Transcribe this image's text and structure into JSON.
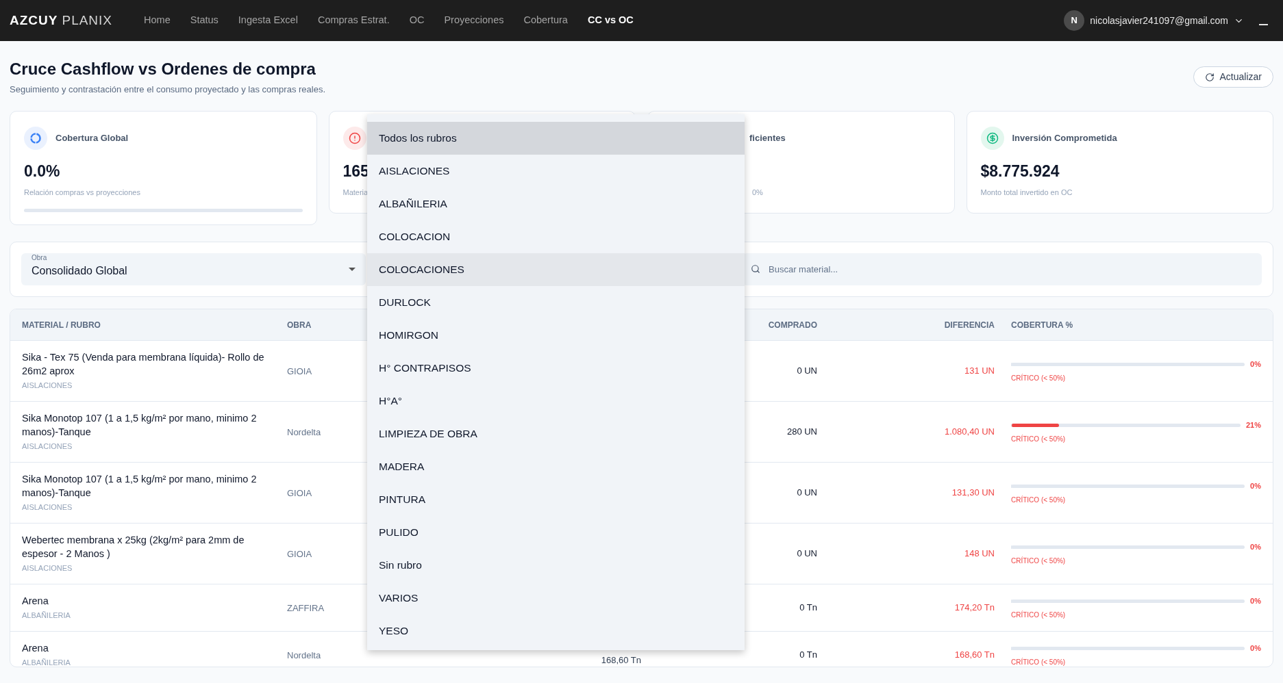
{
  "nav": {
    "brand_bold": "AZCUY",
    "brand_light": "PLANIX",
    "items": [
      {
        "label": "Home",
        "selected": false
      },
      {
        "label": "Status",
        "selected": false
      },
      {
        "label": "Ingesta Excel",
        "selected": false
      },
      {
        "label": "Compras Estrat.",
        "selected": false
      },
      {
        "label": "OC",
        "selected": false
      },
      {
        "label": "Proyecciones",
        "selected": false
      },
      {
        "label": "Cobertura",
        "selected": false
      },
      {
        "label": "CC vs OC",
        "selected": true
      }
    ],
    "user": {
      "avatar": "N",
      "email": "nicolasjavier241097@gmail.com"
    }
  },
  "page": {
    "title": "Cruce Cashflow vs Ordenes de compra",
    "subtitle": "Seguimiento y contrastación entre el consumo proyectado y las compras reales.",
    "refresh_button": "Actualizar"
  },
  "stat_cards": [
    {
      "kind": "coverage",
      "title": "Cobertura Global",
      "value": "0.0%",
      "caption": "Relación compras vs proyecciones",
      "level": 0
    },
    {
      "kind": "alert",
      "value": "165",
      "caption": "Materia"
    },
    {
      "kind": "partial",
      "title": "ficientes",
      "caption": "0%"
    },
    {
      "kind": "investment",
      "title": "Inversión Comprometida",
      "value": "$8.775.924",
      "caption": "Monto total invertido en OC"
    }
  ],
  "filters": {
    "obra": {
      "label": "Obra",
      "value": "Consolidado Global"
    },
    "search": {
      "placeholder": "Buscar material..."
    }
  },
  "table": {
    "columns": [
      "MATERIAL / RUBRO",
      "OBRA",
      "COMPRADO",
      "DIFERENCIA",
      "COBERTURA %"
    ],
    "rows": [
      {
        "material": "Sika - Tex 75 (Venda para membrana líquida)- Rollo de 26m2 aprox",
        "rubro": "AISLACIONES",
        "obra": "GIOIA",
        "comprado": "0 UN",
        "diferencia": "131 UN",
        "coverage": "0%",
        "level": 0,
        "status": {
          "label": "CRÍTICO (< 50%)",
          "kind": "critical"
        }
      },
      {
        "material": "Sika Monotop 107 (1 a 1,5 kg/m² por mano,  minimo 2 manos)-Tanque",
        "rubro": "AISLACIONES",
        "obra": "Nordelta",
        "comprado": "280 UN",
        "diferencia": "1.080,40 UN",
        "coverage": "21%",
        "level": 0.21,
        "status": {
          "label": "CRÍTICO (< 50%)",
          "kind": "critical"
        }
      },
      {
        "material": "Sika Monotop 107 (1 a 1,5 kg/m² por mano,  minimo 2 manos)-Tanque",
        "rubro": "AISLACIONES",
        "obra": "GIOIA",
        "comprado": "0 UN",
        "diferencia": "131,30 UN",
        "coverage": "0%",
        "level": 0,
        "status": {
          "label": "CRÍTICO (< 50%)",
          "kind": "critical"
        }
      },
      {
        "material": "Webertec membrana x 25kg (2kg/m² para 2mm de espesor - 2 Manos )",
        "rubro": "AISLACIONES",
        "obra": "GIOIA",
        "comprado": "0 UN",
        "diferencia": "148 UN",
        "coverage": "0%",
        "level": 0,
        "status": {
          "label": "CRÍTICO (< 50%)",
          "kind": "critical"
        }
      },
      {
        "material": "Arena",
        "rubro": "ALBAÑILERIA",
        "obra": "ZAFFIRA",
        "comprado": "0 Tn",
        "diferencia": "174,20 Tn",
        "coverage": "0%",
        "level": 0,
        "status": {
          "label": "CRÍTICO (< 50%)",
          "kind": "critical"
        }
      },
      {
        "material": "Arena",
        "rubro": "ALBAÑILERIA",
        "obra": "Nordelta",
        "column_3": "168,60 Tn",
        "comprado": "0 Tn",
        "diferencia": "168,60 Tn",
        "coverage": "0%",
        "level": 0,
        "status": {
          "label": "CRÍTICO (< 50%)",
          "kind": "critical"
        }
      }
    ]
  },
  "rubro_dropdown": {
    "options": [
      {
        "label": "Todos los rubros",
        "selected": true,
        "hovered": false
      },
      {
        "label": "AISLACIONES",
        "selected": false,
        "hovered": false
      },
      {
        "label": "ALBAÑILERIA",
        "selected": false,
        "hovered": false
      },
      {
        "label": "COLOCACION",
        "selected": false,
        "hovered": false
      },
      {
        "label": "COLOCACIONES",
        "selected": false,
        "hovered": true
      },
      {
        "label": "DURLOCK",
        "selected": false,
        "hovered": false
      },
      {
        "label": "HOMIRGON",
        "selected": false,
        "hovered": false
      },
      {
        "label": "H° CONTRAPISOS",
        "selected": false,
        "hovered": false
      },
      {
        "label": "H°A°",
        "selected": false,
        "hovered": false
      },
      {
        "label": "LIMPIEZA DE OBRA",
        "selected": false,
        "hovered": false
      },
      {
        "label": "MADERA",
        "selected": false,
        "hovered": false
      },
      {
        "label": "PINTURA",
        "selected": false,
        "hovered": false
      },
      {
        "label": "PULIDO",
        "selected": false,
        "hovered": false
      },
      {
        "label": "Sin rubro",
        "selected": false,
        "hovered": false
      },
      {
        "label": "VARIOS",
        "selected": false,
        "hovered": false
      },
      {
        "label": "YESO",
        "selected": false,
        "hovered": false
      }
    ]
  }
}
